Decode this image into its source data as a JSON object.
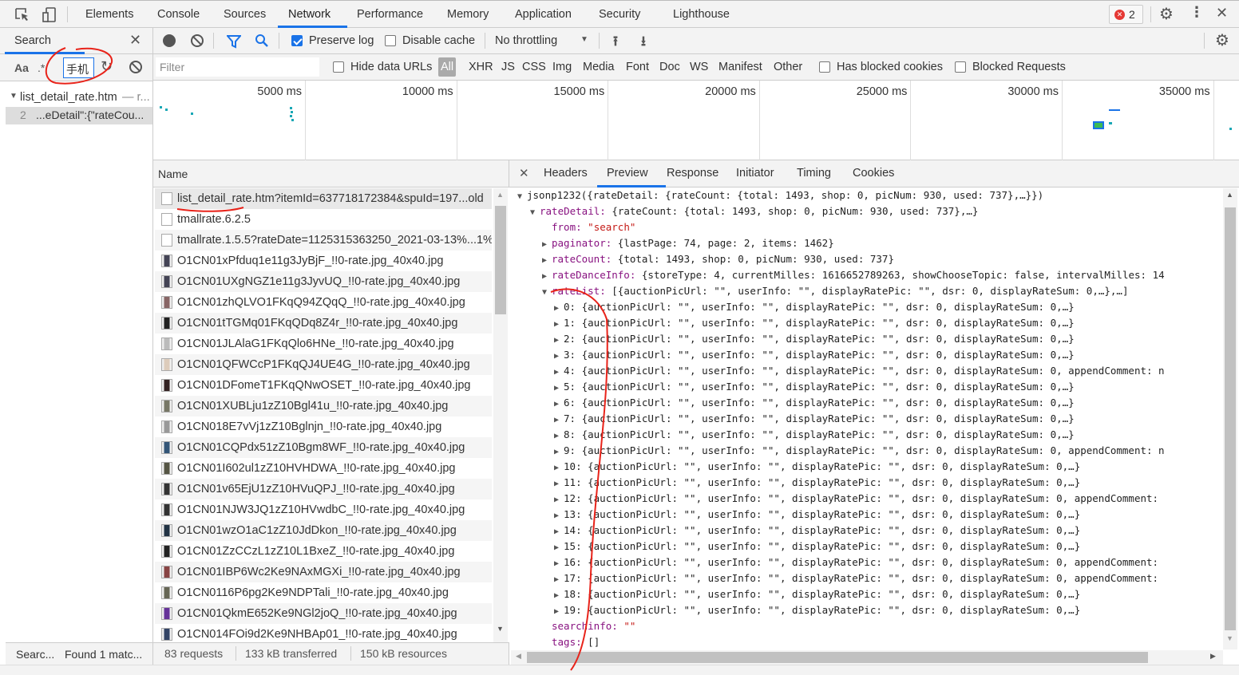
{
  "topbar": {
    "tabs": [
      "Elements",
      "Console",
      "Sources",
      "Network",
      "Performance",
      "Memory",
      "Application",
      "Security",
      "Lighthouse"
    ],
    "active": "Network",
    "error_count": "2"
  },
  "search": {
    "title": "Search",
    "aa": "Aa",
    "regex": ".*",
    "query": "手机",
    "result_file": "list_detail_rate.htm",
    "result_file_suffix": "— r...",
    "result_line": "2",
    "result_text": "...eDetail\":{\"rateCou...",
    "status_left": "Searc...",
    "status_right": "Found 1 matc..."
  },
  "toolbar": {
    "preserve_log": "Preserve log",
    "preserve_log_checked": true,
    "disable_cache": "Disable cache",
    "disable_cache_checked": false,
    "throttling": "No throttling"
  },
  "filter": {
    "placeholder": "Filter",
    "hide_data_urls": "Hide data URLs",
    "types": [
      "All",
      "XHR",
      "JS",
      "CSS",
      "Img",
      "Media",
      "Font",
      "Doc",
      "WS",
      "Manifest",
      "Other"
    ],
    "has_blocked_cookies": "Has blocked cookies",
    "blocked_requests": "Blocked Requests"
  },
  "timeline": {
    "ticks": [
      "5000 ms",
      "10000 ms",
      "15000 ms",
      "20000 ms",
      "25000 ms",
      "30000 ms",
      "35000 ms"
    ]
  },
  "requests": {
    "header": "Name",
    "items": [
      "list_detail_rate.htm?itemId=637718172384&spuId=197...old",
      "tmallrate.6.2.5",
      "tmallrate.1.5.5?rateDate=1125315363250_2021-03-13%...1%",
      "O1CN01xPfduq1e11g3JyBjF_!!0-rate.jpg_40x40.jpg",
      "O1CN01UXgNGZ1e11g3JyvUQ_!!0-rate.jpg_40x40.jpg",
      "O1CN01zhQLVO1FKqQ94ZQqQ_!!0-rate.jpg_40x40.jpg",
      "O1CN01tTGMq01FKqQDq8Z4r_!!0-rate.jpg_40x40.jpg",
      "O1CN01JLAlaG1FKqQlo6HNe_!!0-rate.jpg_40x40.jpg",
      "O1CN01QFWCcP1FKqQJ4UE4G_!!0-rate.jpg_40x40.jpg",
      "O1CN01DFomeT1FKqQNwOSET_!!0-rate.jpg_40x40.jpg",
      "O1CN01XUBLju1zZ10Bgl41u_!!0-rate.jpg_40x40.jpg",
      "O1CN018E7vVj1zZ10Bglnjn_!!0-rate.jpg_40x40.jpg",
      "O1CN01CQPdx51zZ10Bgm8WF_!!0-rate.jpg_40x40.jpg",
      "O1CN01I602ul1zZ10HVHDWA_!!0-rate.jpg_40x40.jpg",
      "O1CN01v65EjU1zZ10HVuQPJ_!!0-rate.jpg_40x40.jpg",
      "O1CN01NJW3JQ1zZ10HVwdbC_!!0-rate.jpg_40x40.jpg",
      "O1CN01wzO1aC1zZ10JdDkon_!!0-rate.jpg_40x40.jpg",
      "O1CN01ZzCCzL1zZ10L1BxeZ_!!0-rate.jpg_40x40.jpg",
      "O1CN01IBP6Wc2Ke9NAxMGXi_!!0-rate.jpg_40x40.jpg",
      "O1CN0116P6pg2Ke9NDPTali_!!0-rate.jpg_40x40.jpg",
      "O1CN01QkmE652Ke9NGl2joQ_!!0-rate.jpg_40x40.jpg",
      "O1CN014FOi9d2Ke9NHBAp01_!!0-rate.jpg_40x40.jpg"
    ]
  },
  "status": {
    "requests": "83 requests",
    "transferred": "133 kB transferred",
    "resources": "150 kB resources"
  },
  "detail_tabs": {
    "tabs": [
      "Headers",
      "Preview",
      "Response",
      "Initiator",
      "Timing",
      "Cookies"
    ],
    "active": "Preview"
  },
  "preview": {
    "lines": [
      {
        "i": 0,
        "t": "open",
        "k": "",
        "v": "jsonp1232({rateDetail: {rateCount: {total: 1493, shop: 0, picNum: 930, used: 737},…}})"
      },
      {
        "i": 1,
        "t": "open",
        "k": "rateDetail",
        "v": "{rateCount: {total: 1493, shop: 0, picNum: 930, used: 737},…}"
      },
      {
        "i": 2,
        "t": "",
        "k": "from",
        "v": "\"search\"",
        "str": true
      },
      {
        "i": 2,
        "t": "closed",
        "k": "paginator",
        "v": "{lastPage: 74, page: 2, items: 1462}"
      },
      {
        "i": 2,
        "t": "closed",
        "k": "rateCount",
        "v": "{total: 1493, shop: 0, picNum: 930, used: 737}"
      },
      {
        "i": 2,
        "t": "closed",
        "k": "rateDanceInfo",
        "v": "{storeType: 4, currentMilles: 1616652789263, showChooseTopic: false, intervalMilles: 14"
      },
      {
        "i": 2,
        "t": "open",
        "k": "rateList",
        "v": "[{auctionPicUrl: \"\", userInfo: \"\", displayRatePic: \"\", dsr: 0, displayRateSum: 0,…},…]"
      },
      {
        "i": 3,
        "t": "closed",
        "k": "0",
        "idx": true,
        "v": "{auctionPicUrl: \"\", userInfo: \"\", displayRatePic: \"\", dsr: 0, displayRateSum: 0,…}"
      },
      {
        "i": 3,
        "t": "closed",
        "k": "1",
        "idx": true,
        "v": "{auctionPicUrl: \"\", userInfo: \"\", displayRatePic: \"\", dsr: 0, displayRateSum: 0,…}"
      },
      {
        "i": 3,
        "t": "closed",
        "k": "2",
        "idx": true,
        "v": "{auctionPicUrl: \"\", userInfo: \"\", displayRatePic: \"\", dsr: 0, displayRateSum: 0,…}"
      },
      {
        "i": 3,
        "t": "closed",
        "k": "3",
        "idx": true,
        "v": "{auctionPicUrl: \"\", userInfo: \"\", displayRatePic: \"\", dsr: 0, displayRateSum: 0,…}"
      },
      {
        "i": 3,
        "t": "closed",
        "k": "4",
        "idx": true,
        "v": "{auctionPicUrl: \"\", userInfo: \"\", displayRatePic: \"\", dsr: 0, displayRateSum: 0, appendComment: n"
      },
      {
        "i": 3,
        "t": "closed",
        "k": "5",
        "idx": true,
        "v": "{auctionPicUrl: \"\", userInfo: \"\", displayRatePic: \"\", dsr: 0, displayRateSum: 0,…}"
      },
      {
        "i": 3,
        "t": "closed",
        "k": "6",
        "idx": true,
        "v": "{auctionPicUrl: \"\", userInfo: \"\", displayRatePic: \"\", dsr: 0, displayRateSum: 0,…}"
      },
      {
        "i": 3,
        "t": "closed",
        "k": "7",
        "idx": true,
        "v": "{auctionPicUrl: \"\", userInfo: \"\", displayRatePic: \"\", dsr: 0, displayRateSum: 0,…}"
      },
      {
        "i": 3,
        "t": "closed",
        "k": "8",
        "idx": true,
        "v": "{auctionPicUrl: \"\", userInfo: \"\", displayRatePic: \"\", dsr: 0, displayRateSum: 0,…}"
      },
      {
        "i": 3,
        "t": "closed",
        "k": "9",
        "idx": true,
        "v": "{auctionPicUrl: \"\", userInfo: \"\", displayRatePic: \"\", dsr: 0, displayRateSum: 0, appendComment: n"
      },
      {
        "i": 3,
        "t": "closed",
        "k": "10",
        "idx": true,
        "v": "{auctionPicUrl: \"\", userInfo: \"\", displayRatePic: \"\", dsr: 0, displayRateSum: 0,…}"
      },
      {
        "i": 3,
        "t": "closed",
        "k": "11",
        "idx": true,
        "v": "{auctionPicUrl: \"\", userInfo: \"\", displayRatePic: \"\", dsr: 0, displayRateSum: 0,…}"
      },
      {
        "i": 3,
        "t": "closed",
        "k": "12",
        "idx": true,
        "v": "{auctionPicUrl: \"\", userInfo: \"\", displayRatePic: \"\", dsr: 0, displayRateSum: 0, appendComment:"
      },
      {
        "i": 3,
        "t": "closed",
        "k": "13",
        "idx": true,
        "v": "{auctionPicUrl: \"\", userInfo: \"\", displayRatePic: \"\", dsr: 0, displayRateSum: 0,…}"
      },
      {
        "i": 3,
        "t": "closed",
        "k": "14",
        "idx": true,
        "v": "{auctionPicUrl: \"\", userInfo: \"\", displayRatePic: \"\", dsr: 0, displayRateSum: 0,…}"
      },
      {
        "i": 3,
        "t": "closed",
        "k": "15",
        "idx": true,
        "v": "{auctionPicUrl: \"\", userInfo: \"\", displayRatePic: \"\", dsr: 0, displayRateSum: 0,…}"
      },
      {
        "i": 3,
        "t": "closed",
        "k": "16",
        "idx": true,
        "v": "{auctionPicUrl: \"\", userInfo: \"\", displayRatePic: \"\", dsr: 0, displayRateSum: 0, appendComment:"
      },
      {
        "i": 3,
        "t": "closed",
        "k": "17",
        "idx": true,
        "v": "{auctionPicUrl: \"\", userInfo: \"\", displayRatePic: \"\", dsr: 0, displayRateSum: 0, appendComment:"
      },
      {
        "i": 3,
        "t": "closed",
        "k": "18",
        "idx": true,
        "v": "{auctionPicUrl: \"\", userInfo: \"\", displayRatePic: \"\", dsr: 0, displayRateSum: 0,…}"
      },
      {
        "i": 3,
        "t": "closed",
        "k": "19",
        "idx": true,
        "v": "{auctionPicUrl: \"\", userInfo: \"\", displayRatePic: \"\", dsr: 0, displayRateSum: 0,…}"
      },
      {
        "i": 2,
        "t": "",
        "k": "searchinfo",
        "v": "\"\"",
        "str": true
      },
      {
        "i": 2,
        "t": "",
        "k": "tags",
        "v": "[]"
      }
    ]
  },
  "colors": {
    "accent": "#1a73e8",
    "annotation": "#e8231a",
    "key": "#881280",
    "string": "#c41a16",
    "error": "#e53935"
  }
}
